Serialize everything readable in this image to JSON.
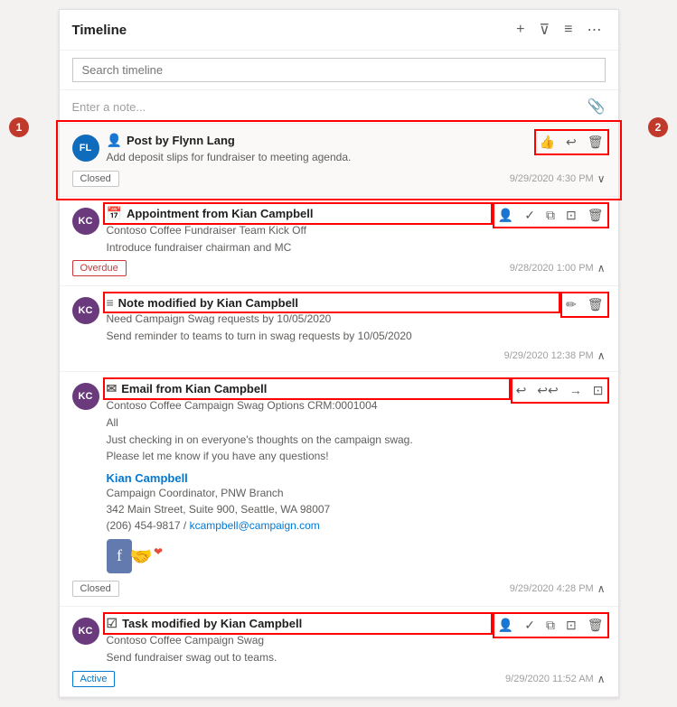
{
  "panel": {
    "title": "Timeline",
    "search_placeholder": "Search timeline",
    "note_placeholder": "Enter a note..."
  },
  "header_icons": {
    "add": "+",
    "filter": "⊽",
    "sort": "≡",
    "more": "⋯"
  },
  "items": [
    {
      "id": "post-flynn",
      "type": "Post",
      "type_icon": "👤",
      "author": "Flynn Lang",
      "title": "Post by Flynn Lang",
      "desc": "Add deposit slips for fundraiser to meeting agenda.",
      "badge": "Closed",
      "badge_type": "closed",
      "timestamp": "9/29/2020 4:30 PM",
      "expanded": true,
      "actions": [
        "thumb",
        "reply",
        "delete"
      ],
      "avatar": "FL",
      "avatar_class": "avatar-fl"
    },
    {
      "id": "appt-kian",
      "type": "Appointment",
      "type_icon": "📅",
      "author": "Kian Campbell",
      "title": "Appointment from Kian Campbell",
      "desc1": "Contoso Coffee Fundraiser Team Kick Off",
      "desc2": "Introduce fundraiser chairman and MC",
      "badge": "Overdue",
      "badge_type": "overdue",
      "timestamp": "9/28/2020 1:00 PM",
      "expanded": false,
      "actions": [
        "assign",
        "check",
        "copy",
        "open",
        "delete"
      ],
      "avatar": "KC",
      "avatar_class": "avatar-kc"
    },
    {
      "id": "note-kian",
      "type": "Note",
      "type_icon": "📝",
      "author": "Kian Campbell",
      "title": "Note modified by Kian Campbell",
      "desc1": "Need Campaign Swag requests by 10/05/2020",
      "desc2": "Send reminder to teams to turn in swag requests by 10/05/2020",
      "badge": "",
      "badge_type": "",
      "timestamp": "9/29/2020 12:38 PM",
      "expanded": false,
      "actions": [
        "edit",
        "delete"
      ],
      "avatar": "KC",
      "avatar_class": "avatar-kc"
    },
    {
      "id": "email-kian",
      "type": "Email",
      "type_icon": "✉",
      "author": "Kian Campbell",
      "title": "Email from Kian Campbell",
      "desc1": "Contoso Coffee Campaign Swag Options CRM:0001004",
      "desc2": "All",
      "desc3": "Just checking in on everyone's thoughts on the campaign swag.",
      "desc4": "Please let me know if you have any questions!",
      "sig_name": "Kian Campbell",
      "sig_role": "Campaign Coordinator, PNW Branch",
      "sig_addr": "342 Main Street, Suite 900, Seattle, WA 98007",
      "sig_phone": "(206) 454-9817",
      "sig_email": "kcampbell@campaign.com",
      "badge": "Closed",
      "badge_type": "closed",
      "timestamp": "9/29/2020 4:28 PM",
      "expanded": false,
      "actions": [
        "reply",
        "reply-all",
        "forward",
        "open"
      ],
      "avatar": "KC",
      "avatar_class": "avatar-kc"
    },
    {
      "id": "task-kian",
      "type": "Task",
      "type_icon": "☑",
      "author": "Kian Campbell",
      "title": "Task modified by Kian Campbell",
      "desc1": "Contoso Coffee Campaign Swag",
      "desc2": "Send fundraiser swag out to teams.",
      "badge": "Active",
      "badge_type": "active",
      "timestamp": "9/29/2020 11:52 AM",
      "expanded": false,
      "actions": [
        "assign",
        "check",
        "copy",
        "open",
        "delete"
      ],
      "avatar": "KC",
      "avatar_class": "avatar-kc"
    }
  ]
}
